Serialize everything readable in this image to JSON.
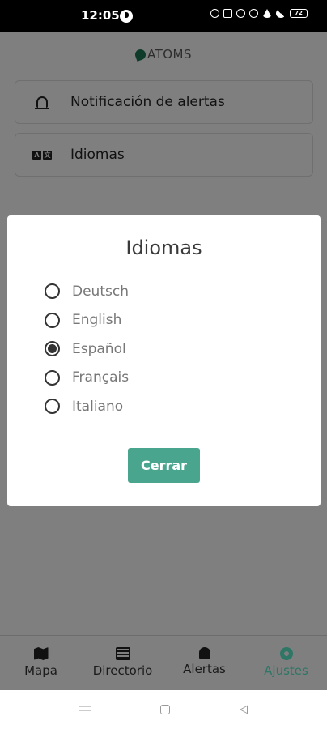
{
  "status_bar": {
    "time": "12:05",
    "battery": "72"
  },
  "header": {
    "logo_text": "ATOMS"
  },
  "settings": {
    "items": [
      {
        "label": "Notificación de alertas",
        "icon": "bell-icon"
      },
      {
        "label": "Idiomas",
        "icon": "language-icon"
      }
    ]
  },
  "dialog": {
    "title": "Idiomas",
    "options": [
      {
        "label": "Deutsch",
        "selected": false
      },
      {
        "label": "English",
        "selected": false
      },
      {
        "label": "Español",
        "selected": true
      },
      {
        "label": "Français",
        "selected": false
      },
      {
        "label": "Italiano",
        "selected": false
      }
    ],
    "close_label": "Cerrar"
  },
  "bottom_nav": {
    "items": [
      {
        "label": "Mapa",
        "icon": "map-icon",
        "active": false
      },
      {
        "label": "Directorio",
        "icon": "directory-icon",
        "active": false
      },
      {
        "label": "Alertas",
        "icon": "bell-icon",
        "active": false
      },
      {
        "label": "Ajustes",
        "icon": "gear-icon",
        "active": true
      }
    ]
  },
  "colors": {
    "accent": "#4aa58e",
    "active_nav": "#2e7666",
    "scrim": "#7f7f7f"
  }
}
